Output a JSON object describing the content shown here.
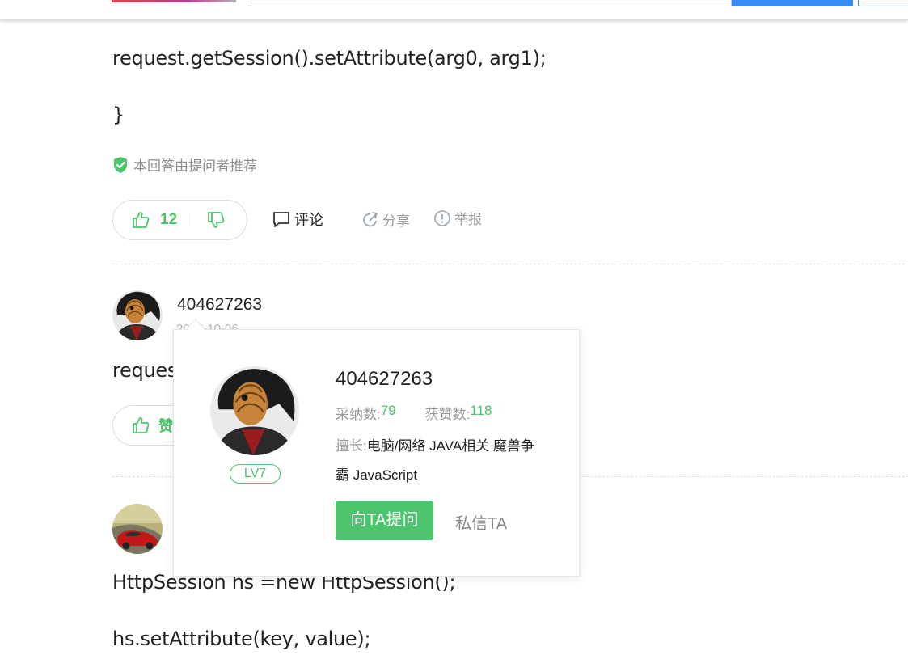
{
  "code_lines": {
    "line1": "request.getSession().setAttribute(arg0, arg1);",
    "line2": "}",
    "line3_partial": "reques",
    "line4": "HttpSession hs =new HttpSession();",
    "line5": "hs.setAttribute(key, value);"
  },
  "answer1": {
    "recommend_text": "本回答由提问者推荐",
    "like_count": "12",
    "comment_label": "评论",
    "share_label": "分享",
    "report_label": "举报"
  },
  "answer2": {
    "username": "404627263",
    "date": "2018-10-06",
    "like_label": "赞"
  },
  "user_card": {
    "name": "404627263",
    "level": "LV7",
    "adopted_label": "采纳数:",
    "adopted_value": "79",
    "likes_label": "获赞数:",
    "likes_value": "118",
    "skill_label": "擅长:",
    "skill_text": "电脑/网络 JAVA相关 魔兽争霸 JavaScript",
    "ask_button": "向TA提问",
    "message_button": "私信TA"
  },
  "colors": {
    "accent_green": "#4cc36d",
    "muted_gray": "#999999",
    "search_blue": "#3a8ef6"
  },
  "icons": [
    "shield-check-icon",
    "thumbs-up-icon",
    "thumbs-down-icon",
    "comment-icon",
    "share-icon",
    "report-icon"
  ]
}
